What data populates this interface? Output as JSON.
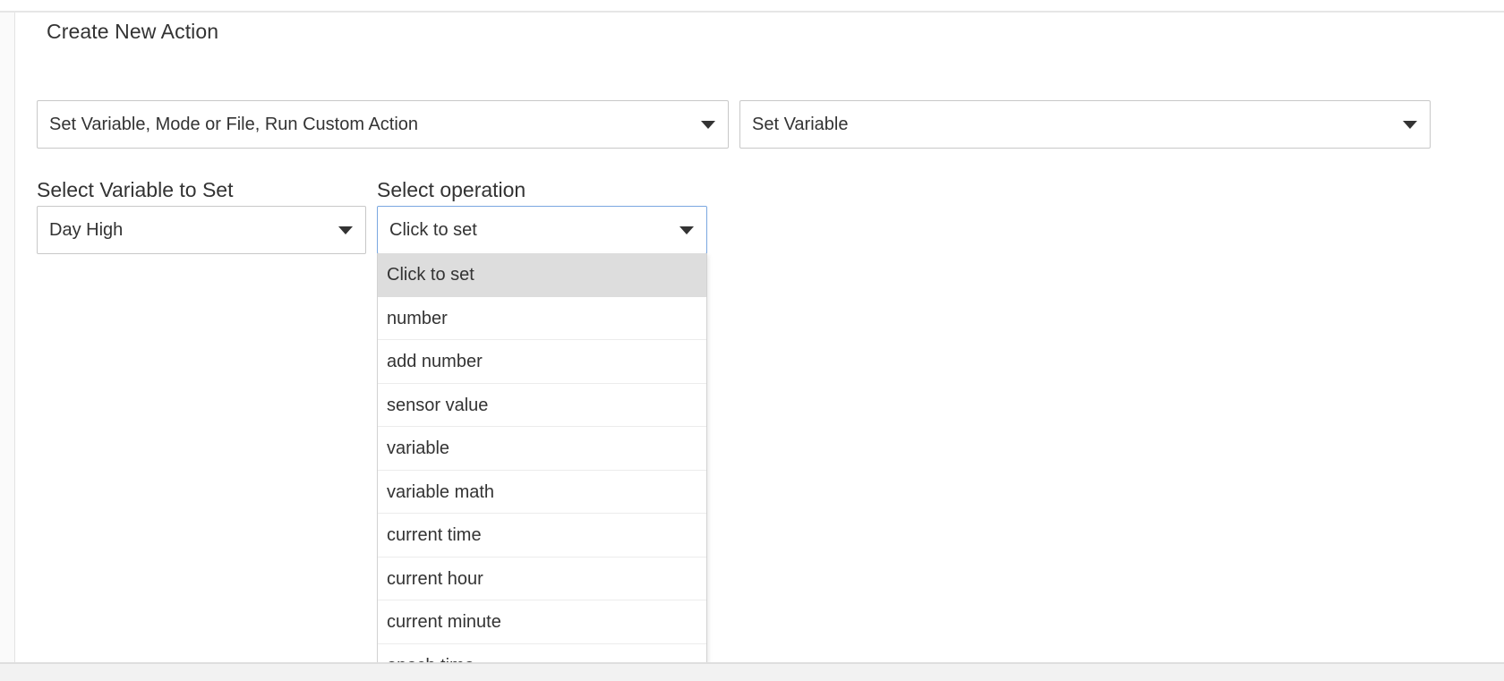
{
  "card": {
    "title": "Create New Action"
  },
  "action_category_select": {
    "value": "Set Variable, Mode or File, Run Custom Action"
  },
  "action_type_select": {
    "value": "Set Variable"
  },
  "variable_field": {
    "label": "Select Variable to Set",
    "value": "Day High"
  },
  "operation_field": {
    "label": "Select operation",
    "value": "Click to set",
    "options": [
      "Click to set",
      "number",
      "add number",
      "sensor value",
      "variable",
      "variable math",
      "current time",
      "current hour",
      "current minute",
      "epoch time"
    ],
    "highlighted_option": "Click to set"
  },
  "icons": {
    "dropdown_caret": "caret-down-icon"
  },
  "colors": {
    "focus_border": "#7aa7e0",
    "option_highlight": "#dddddd",
    "text": "#333333"
  }
}
